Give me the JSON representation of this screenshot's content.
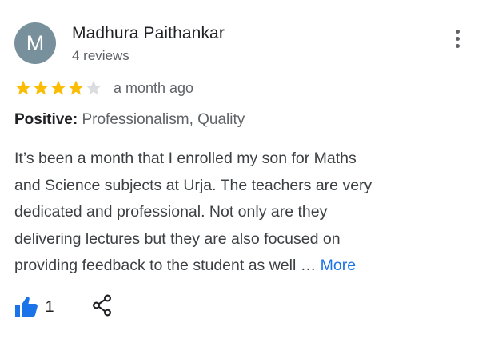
{
  "review": {
    "author": {
      "initial": "M",
      "name": "Madhura Paithankar",
      "review_count": "4 reviews",
      "avatar_color": "#78909c"
    },
    "rating": {
      "stars": 4,
      "max": 5,
      "filled_color": "#fbbc04",
      "empty_color": "#dadce0"
    },
    "time_ago": "a month ago",
    "attributes": {
      "label": "Positive:",
      "value": "Professionalism, Quality"
    },
    "text_lines": [
      "It’s been a month that I enrolled my son for Maths",
      "and Science subjects at Urja. The teachers are very",
      "dedicated and professional. Not only are they",
      "delivering lectures but they are also focused on",
      "providing feedback to the student as well …"
    ],
    "more_label": "More",
    "likes": "1",
    "icons": {
      "menu": "more-vert-icon",
      "like": "thumbs-up-icon",
      "share": "share-icon"
    },
    "accent_color": "#1a73e8"
  }
}
